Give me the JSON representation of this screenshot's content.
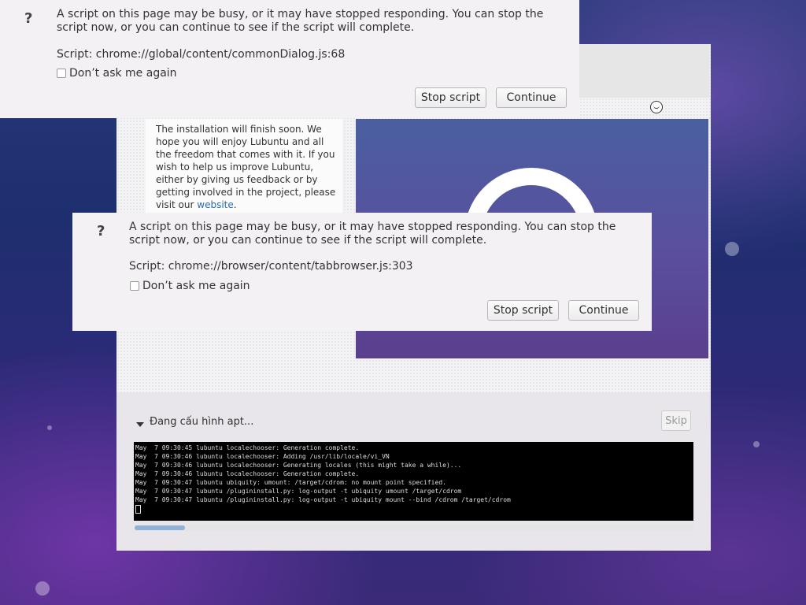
{
  "installer": {
    "slide_text": "The installation will finish soon. We hope you will enjoy Lubuntu and all the freedom that comes with it. If you wish to help us improve Lubuntu, either by giving us feedback or by getting involved in the project, please visit our",
    "slide_link": "website",
    "slide_text_end": ".",
    "progress_label": "Đang cấu hình apt...",
    "skip_label": "Skip",
    "terminal_lines": [
      "May  7 09:30:45 lubuntu localechooser: Generation complete.",
      "May  7 09:30:46 lubuntu localechooser: Adding /usr/lib/locale/vi_VN",
      "May  7 09:30:46 lubuntu localechooser: Generating locales (this might take a while)...",
      "May  7 09:30:46 lubuntu localechooser: Generation complete.",
      "May  7 09:30:47 lubuntu ubiquity: umount: /target/cdrom: no mount point specified.",
      "May  7 09:30:47 lubuntu /plugininstall.py: log-output -t ubiquity umount /target/cdrom",
      "May  7 09:30:47 lubuntu /plugininstall.py: log-output -t ubiquity mount --bind /cdrom /target/cdrom"
    ]
  },
  "dialog1": {
    "icon": "?",
    "message": "A script on this page may be busy, or it may have stopped responding. You can stop the script now, or you can continue to see if the script will complete.",
    "script": "Script: chrome://global/content/commonDialog.js:68",
    "checkbox_label": "Don’t ask me again",
    "stop_label": "Stop script",
    "continue_label": "Continue"
  },
  "dialog2": {
    "icon": "?",
    "message": "A script on this page may be busy, or it may have stopped responding. You can stop the script now, or you can continue to see if the script will complete.",
    "script": "Script: chrome://browser/content/tabbrowser.js:303",
    "checkbox_label": "Don’t ask me again",
    "stop_label": "Stop script",
    "continue_label": "Continue"
  }
}
